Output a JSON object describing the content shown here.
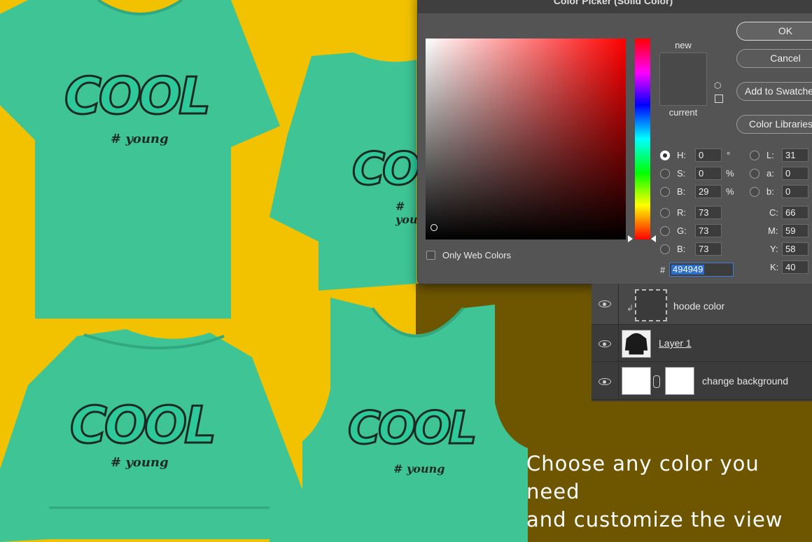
{
  "colors": {
    "background_yellow": "#f2c200",
    "background_olive": "#6e5600",
    "shirt_green": "#3ec495",
    "selected_color": "#494949"
  },
  "dialog": {
    "title": "Color Picker (Solid Color)",
    "label_new": "new",
    "label_current": "current",
    "buttons": {
      "ok": "OK",
      "cancel": "Cancel",
      "add_to_swatches": "Add to Swatches",
      "color_libraries": "Color Libraries"
    },
    "fields": {
      "h": {
        "label": "H:",
        "value": "0",
        "unit": "°"
      },
      "s": {
        "label": "S:",
        "value": "0",
        "unit": "%"
      },
      "b": {
        "label": "B:",
        "value": "29",
        "unit": "%"
      },
      "r": {
        "label": "R:",
        "value": "73"
      },
      "g": {
        "label": "G:",
        "value": "73"
      },
      "b2": {
        "label": "B:",
        "value": "73"
      },
      "l": {
        "label": "L:",
        "value": "31"
      },
      "a": {
        "label": "a:",
        "value": "0"
      },
      "lab_b": {
        "label": "b:",
        "value": "0"
      },
      "c": {
        "label": "C:",
        "value": "66"
      },
      "m": {
        "label": "M:",
        "value": "59"
      },
      "y": {
        "label": "Y:",
        "value": "58"
      },
      "k": {
        "label": "K:",
        "value": "40"
      }
    },
    "only_web_colors": "Only Web Colors",
    "hash": "#",
    "hex_value": "494949"
  },
  "layers": [
    {
      "name": "hoode color"
    },
    {
      "name": "Layer 1"
    },
    {
      "name": "change background"
    }
  ],
  "artwork": {
    "graffiti_word": "COOL",
    "tag": "# young"
  },
  "caption": "Choose any color you need\nand customize the view"
}
